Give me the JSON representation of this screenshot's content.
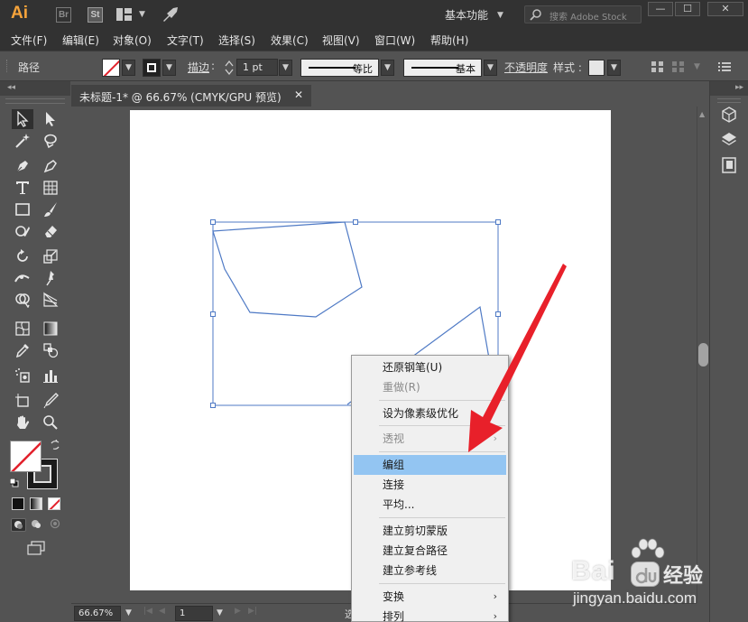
{
  "titlebar": {
    "logo": "Ai",
    "bridge": "Br",
    "stock": "St",
    "workspace": "基本功能",
    "search_placeholder": "搜索 Adobe Stock",
    "minimize": "—",
    "maximize": "☐",
    "close": "✕"
  },
  "menubar": {
    "items": [
      "文件(F)",
      "编辑(E)",
      "对象(O)",
      "文字(T)",
      "选择(S)",
      "效果(C)",
      "视图(V)",
      "窗口(W)",
      "帮助(H)"
    ]
  },
  "controlbar": {
    "object_type": "路径",
    "stroke_label": "描边",
    "stroke_colon": ":",
    "stroke_weight": "1 pt",
    "profile_label": "等比",
    "brush_label": "基本",
    "opacity_label": "不透明度",
    "style_label": "样式 :"
  },
  "toolbar": {
    "collapse": "◂◂"
  },
  "document": {
    "tab_title": "未标题-1* @ 66.67% (CMYK/GPU 预览)",
    "close": "✕"
  },
  "statusbar": {
    "zoom": "66.67%",
    "page": "1",
    "status_text": "选"
  },
  "right_panel": {
    "collapse": "▸▸"
  },
  "context_menu": {
    "items": [
      {
        "label": "还原钢笔(U)",
        "enabled": true
      },
      {
        "label": "重做(R)",
        "enabled": false
      },
      {
        "label": "设为像素级优化",
        "enabled": true
      },
      {
        "label": "透视",
        "enabled": false,
        "submenu": true
      },
      {
        "label": "编组",
        "enabled": true,
        "highlighted": true
      },
      {
        "label": "连接",
        "enabled": true
      },
      {
        "label": "平均...",
        "enabled": true
      },
      {
        "label": "建立剪切蒙版",
        "enabled": true
      },
      {
        "label": "建立复合路径",
        "enabled": true
      },
      {
        "label": "建立参考线",
        "enabled": true
      },
      {
        "label": "变换",
        "enabled": true,
        "submenu": true
      },
      {
        "label": "排列",
        "enabled": true,
        "submenu": true
      }
    ],
    "submenu_arrow": "›"
  },
  "watermark": {
    "brand_left": "Bai",
    "brand_right": "经验",
    "url": "jingyan.baidu.com"
  },
  "colors": {
    "ai_orange": "#f7a43b",
    "path_blue": "#3e6fb5",
    "highlight_blue": "#93c5f2",
    "arrow_red": "#e8202a"
  }
}
